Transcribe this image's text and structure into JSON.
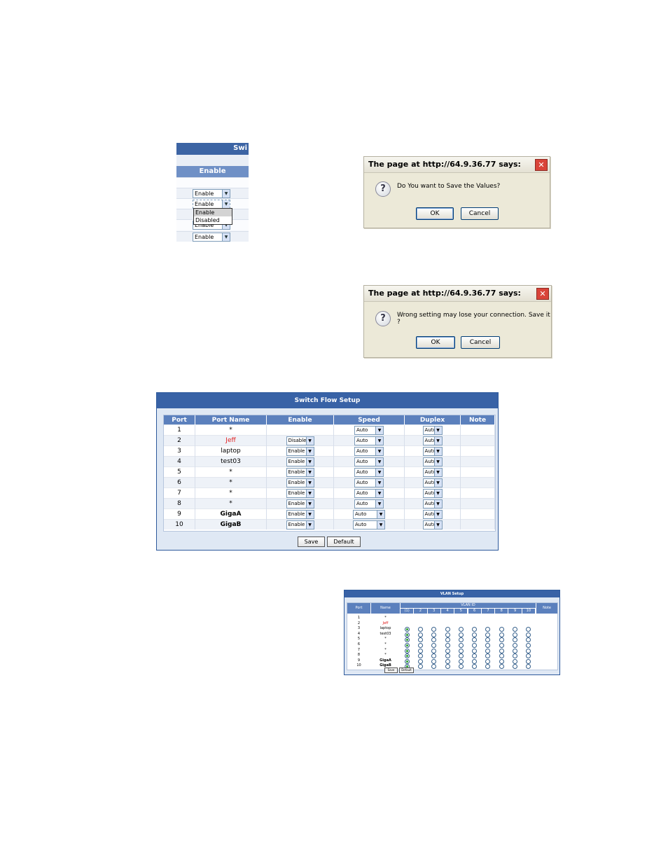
{
  "crop": {
    "title_partial": "Swi",
    "header": "Enable",
    "rows": [
      "Enable",
      "Enable",
      "Enable",
      "Enable"
    ],
    "dropdown_options": [
      "Enable",
      "Disabled"
    ],
    "dropdown_highlight": "Enable"
  },
  "dialog1": {
    "title": "The page at http://64.9.36.77 says:",
    "message": "Do You want to Save the Values?",
    "ok": "OK",
    "cancel": "Cancel",
    "icon": "question-icon"
  },
  "dialog2": {
    "title": "The page at http://64.9.36.77 says:",
    "message": "Wrong setting may lose your connection. Save it ?",
    "ok": "OK",
    "cancel": "Cancel",
    "icon": "question-icon"
  },
  "flow": {
    "title": "Switch Flow Setup",
    "columns": [
      "Port",
      "Port Name",
      "Enable",
      "Speed",
      "Duplex",
      "Note"
    ],
    "rows": [
      {
        "port": "1",
        "name": "*",
        "enable": "",
        "speed": "Auto",
        "duplex": "Auto"
      },
      {
        "port": "2",
        "name": "Jeff",
        "enable": "Disabled",
        "speed": "Auto",
        "duplex": "Auto"
      },
      {
        "port": "3",
        "name": "laptop",
        "enable": "Enable",
        "speed": "Auto",
        "duplex": "Auto"
      },
      {
        "port": "4",
        "name": "test03",
        "enable": "Enable",
        "speed": "Auto",
        "duplex": "Auto"
      },
      {
        "port": "5",
        "name": "*",
        "enable": "Enable",
        "speed": "Auto",
        "duplex": "Auto"
      },
      {
        "port": "6",
        "name": "*",
        "enable": "Enable",
        "speed": "Auto",
        "duplex": "Auto"
      },
      {
        "port": "7",
        "name": "*",
        "enable": "Enable",
        "speed": "Auto",
        "duplex": "Auto"
      },
      {
        "port": "8",
        "name": "*",
        "enable": "Enable",
        "speed": "Auto",
        "duplex": "Auto"
      },
      {
        "port": "9",
        "name": "GigaA",
        "enable": "Enable",
        "speed": "Auto",
        "duplex": "Auto"
      },
      {
        "port": "10",
        "name": "GigaB",
        "enable": "Enable",
        "speed": "Auto",
        "duplex": "Auto"
      }
    ],
    "save": "Save",
    "default": "Default"
  },
  "vlan": {
    "title": "VLAN Setup",
    "col_port": "Port",
    "col_name": "Name",
    "col_vlan": "VLAN ID",
    "col_note": "Note",
    "vlan_ids": [
      "(1)",
      "2",
      "3",
      "4",
      "5",
      "6",
      "7",
      "8",
      "9",
      "10"
    ],
    "rows": [
      {
        "port": "1",
        "name": "*",
        "radios": false,
        "selected": 0
      },
      {
        "port": "2",
        "name": "Jeff",
        "radios": false,
        "selected": 0
      },
      {
        "port": "3",
        "name": "laptop",
        "radios": true,
        "selected": 0
      },
      {
        "port": "4",
        "name": "test03",
        "radios": true,
        "selected": 0
      },
      {
        "port": "5",
        "name": "*",
        "radios": true,
        "selected": 0
      },
      {
        "port": "6",
        "name": "*",
        "radios": true,
        "selected": 0
      },
      {
        "port": "7",
        "name": "*",
        "radios": true,
        "selected": 0
      },
      {
        "port": "8",
        "name": "*",
        "radios": true,
        "selected": 0
      },
      {
        "port": "9",
        "name": "GigaA",
        "radios": true,
        "selected": 0
      },
      {
        "port": "10",
        "name": "GigaB",
        "radios": true,
        "selected": 0
      }
    ],
    "save": "Save",
    "default": "Default"
  }
}
